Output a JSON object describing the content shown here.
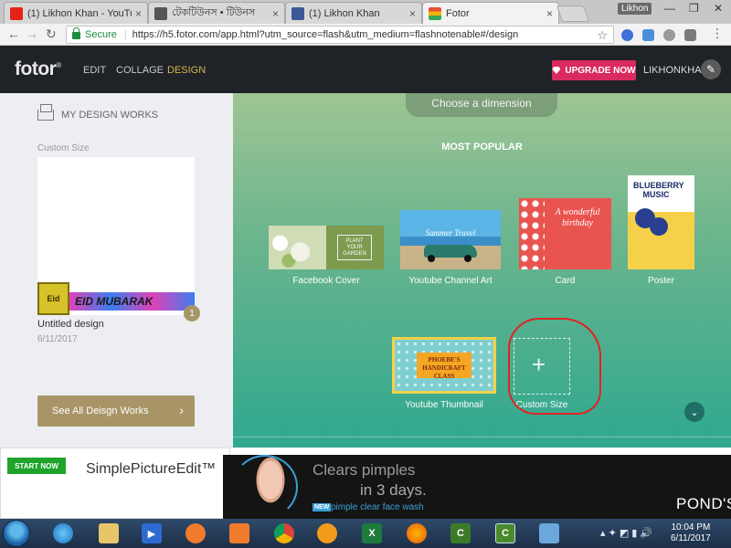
{
  "browser": {
    "tabs": [
      {
        "title": "(1) Likhon Khan - YouTube",
        "icon": "youtube-icon",
        "color": "#e62117"
      },
      {
        "title": "টেকটিউনস • টিউনস",
        "icon": "techtunes-icon",
        "color": "#555555"
      },
      {
        "title": "(1) Likhon Khan",
        "icon": "facebook-icon",
        "color": "#3b5998"
      },
      {
        "title": "Fotor",
        "icon": "fotor-icon",
        "color": "#f3b400"
      }
    ],
    "user_badge": "Likhon",
    "secure_label": "Secure",
    "url": "https://h5.fotor.com/app.html?utm_source=flash&utm_medium=flashnotenable#/design"
  },
  "fotor": {
    "logo": "fotor",
    "nav": [
      {
        "label": "EDIT",
        "active": false
      },
      {
        "label": "COLLAGE",
        "active": false
      },
      {
        "label": "DESIGN",
        "active": true
      }
    ],
    "upgrade_label": "UPGRADE NOW",
    "username": "LIKHONKHA"
  },
  "sidebar": {
    "title": "MY DESIGN WORKS",
    "custom_size_label": "Custom Size",
    "thumb_logo_text": "Eid",
    "thumb_banner_text": "EID MUBARAK",
    "count_badge": "1",
    "design_name": "Untitled design",
    "design_date": "6/11/2017",
    "see_all_label": "See All Deisgn Works"
  },
  "main": {
    "choose_label": "Choose a dimension",
    "section_title": "MOST POPULAR",
    "templates": [
      {
        "label": "Facebook Cover",
        "card_text": "PLANT YOUR GARDEN"
      },
      {
        "label": "Youtube Channel Art",
        "card_text": "Summer Travel"
      },
      {
        "label": "Card",
        "card_text": "A wonderful birthday"
      },
      {
        "label": "Poster",
        "card_text": "BLUEBERRY MUSIC"
      },
      {
        "label": "Youtube Thumbnail",
        "card_text": "PHOEBE'S HANDICRAFT CLASS"
      }
    ],
    "custom_size": {
      "label": "Custom Size",
      "plus": "+"
    }
  },
  "ad": {
    "start_label": "START NOW",
    "spe_label": "SimplePictureEdit™",
    "headline1": "Clears pimples",
    "headline2": "in 3 days.",
    "new_badge": "NEW",
    "subline": "pimple clear face wash",
    "brand": "POND'S"
  },
  "taskbar": {
    "time": "10:04 PM",
    "date": "6/11/2017"
  }
}
